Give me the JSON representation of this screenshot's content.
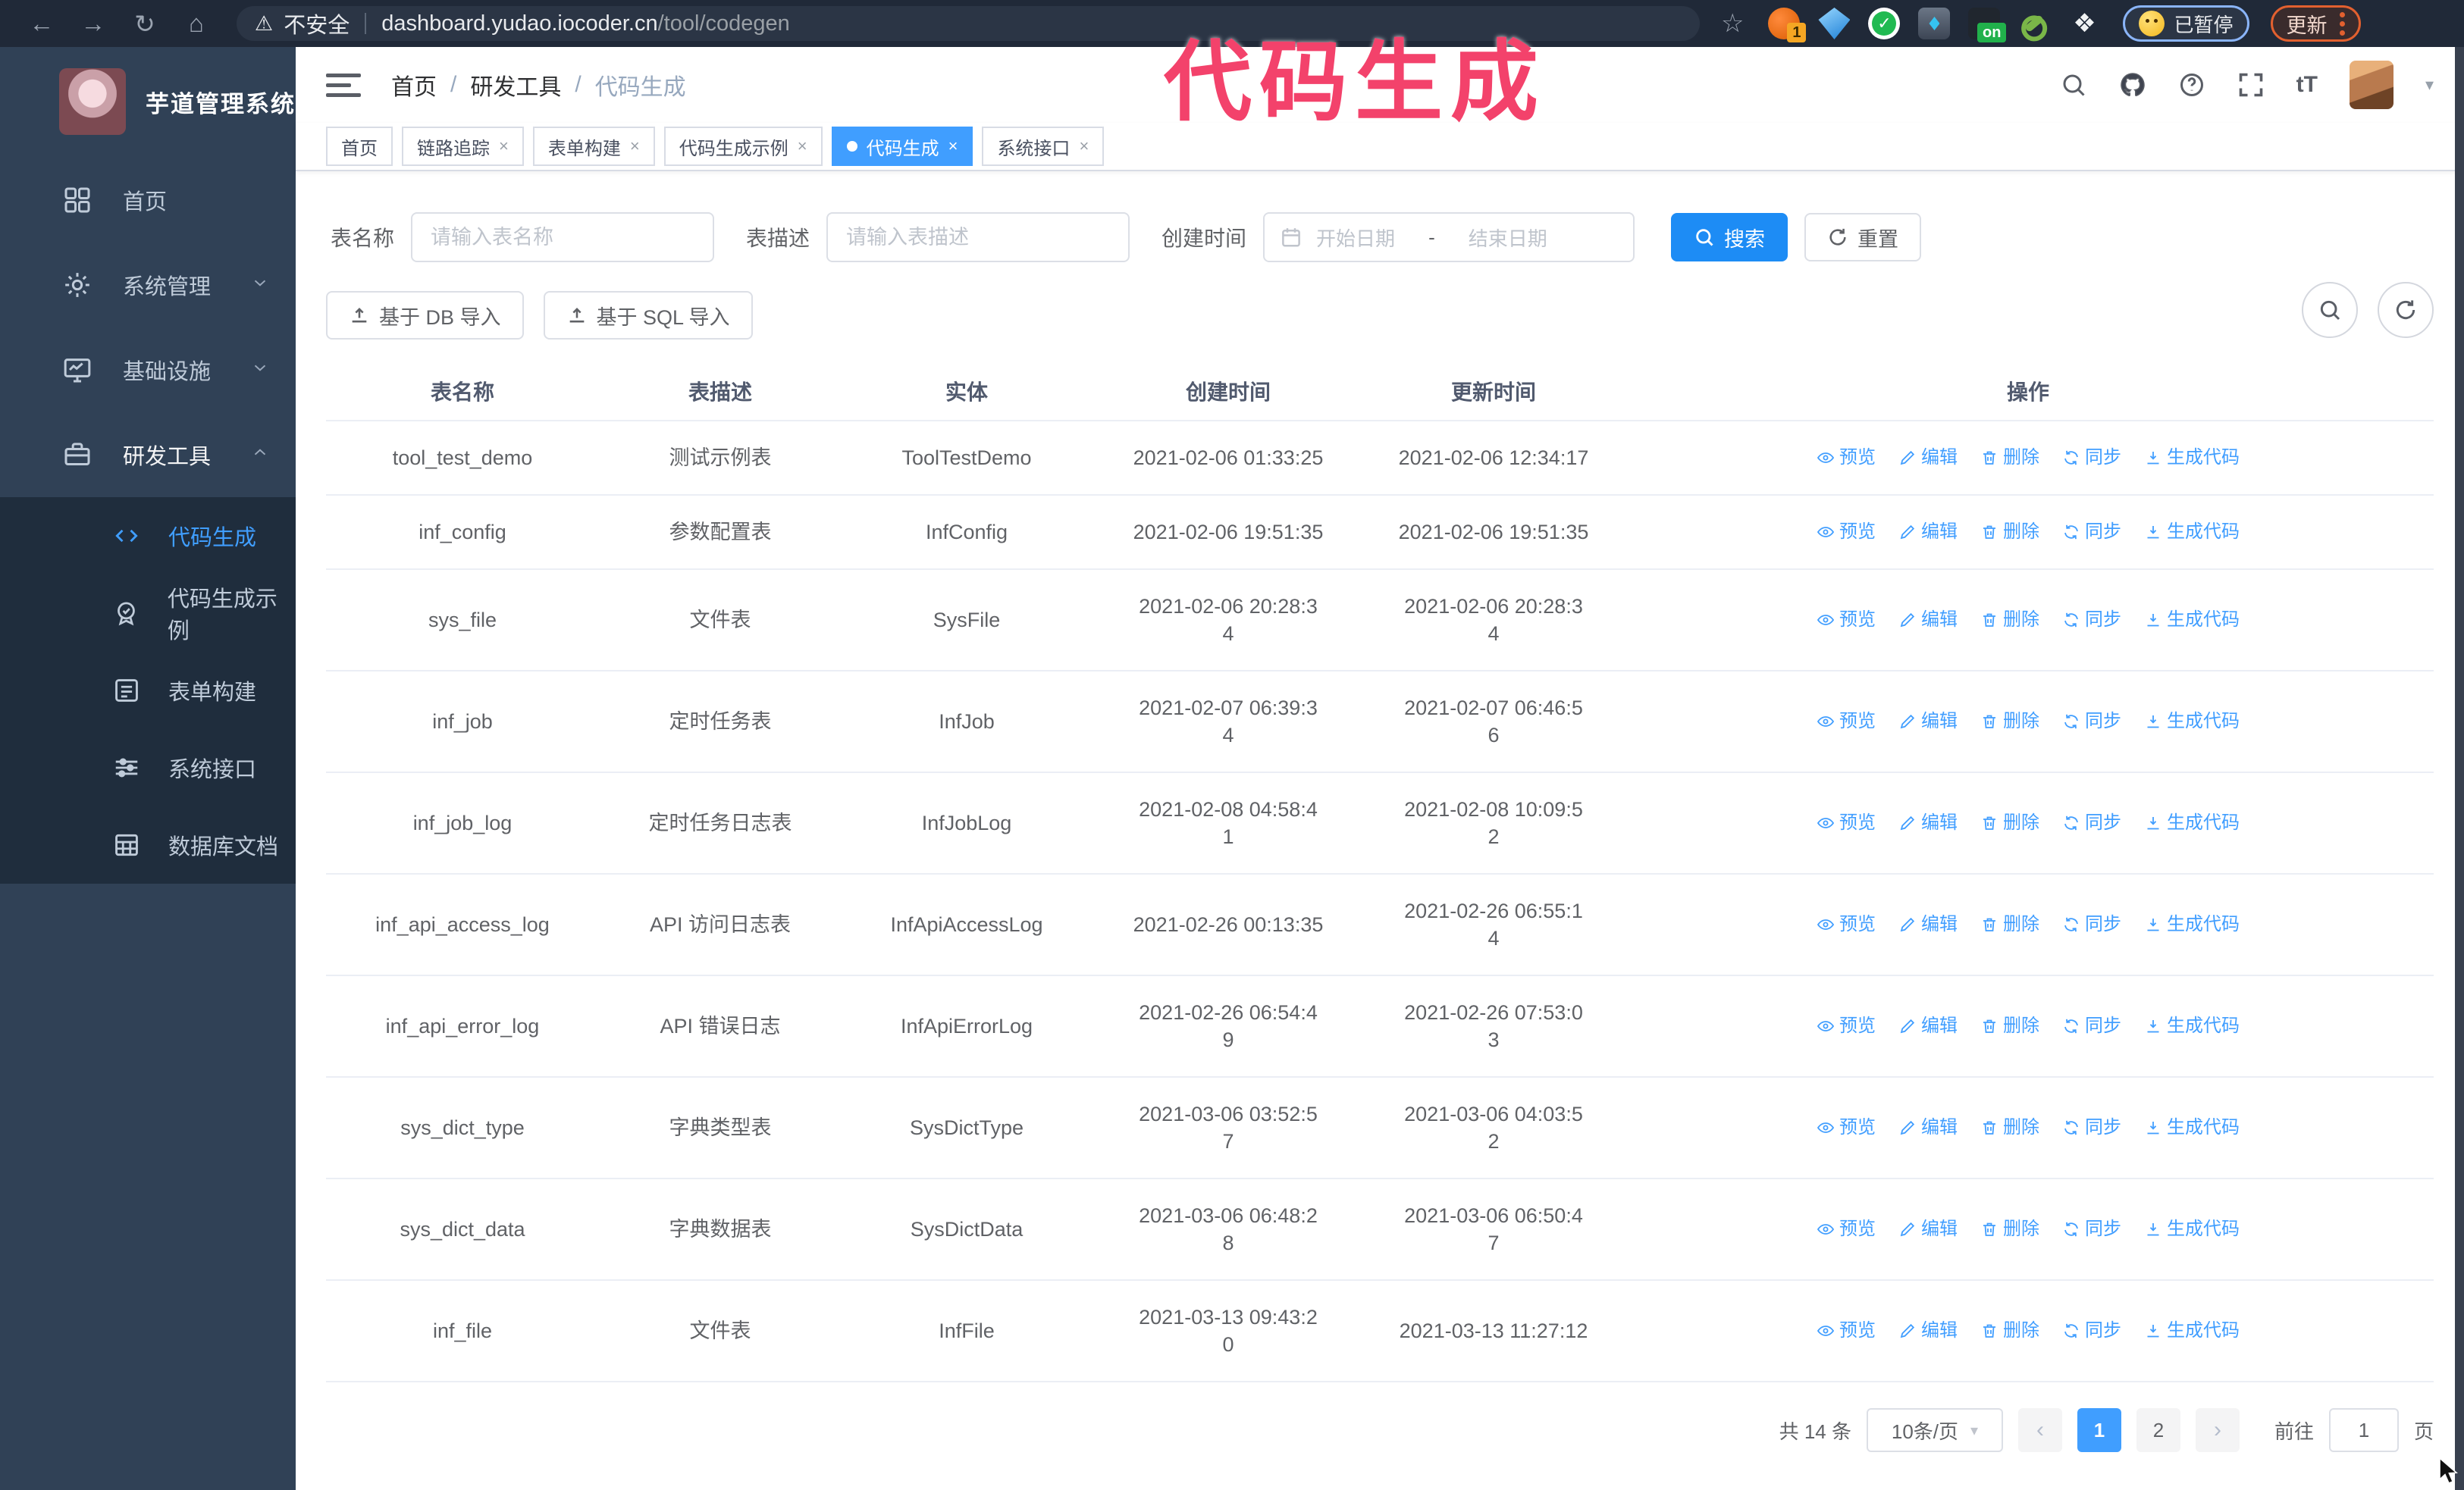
{
  "colors": {
    "primary": "#409eff",
    "search_button": "#1d8cf5",
    "sidebar_bg": "#304156",
    "submenu_bg": "#1f2d3d",
    "annotation_pink": "#f3426b",
    "tag_active": "#409eff"
  },
  "browser": {
    "security_label": "不安全",
    "url_host": "dashboard.yudao.iocoder.cn",
    "url_path": "/tool/codegen",
    "ext_badge": "1",
    "ext_on_badge": "on",
    "paused_label": "已暂停",
    "update_label": "更新"
  },
  "annotation": {
    "text": "代码生成"
  },
  "sidebar": {
    "title": "芋道管理系统",
    "items": [
      {
        "label": "首页",
        "icon": "dashboard-icon",
        "chevron": "",
        "open": false
      },
      {
        "label": "系统管理",
        "icon": "gear-icon",
        "chevron": "down",
        "open": false
      },
      {
        "label": "基础设施",
        "icon": "monitor-icon",
        "chevron": "down",
        "open": false
      },
      {
        "label": "研发工具",
        "icon": "toolbox-icon",
        "chevron": "up",
        "open": true
      }
    ],
    "submenu": [
      {
        "label": "代码生成",
        "icon": "code-icon",
        "active": true
      },
      {
        "label": "代码生成示例",
        "icon": "medal-icon",
        "active": false
      },
      {
        "label": "表单构建",
        "icon": "form-icon",
        "active": false
      },
      {
        "label": "系统接口",
        "icon": "sliders-icon",
        "active": false
      },
      {
        "label": "数据库文档",
        "icon": "db-doc-icon",
        "active": false
      }
    ]
  },
  "header": {
    "breadcrumb": [
      "首页",
      "研发工具",
      "代码生成"
    ]
  },
  "tabs": [
    {
      "label": "首页",
      "closable": false,
      "active": false
    },
    {
      "label": "链路追踪",
      "closable": true,
      "active": false
    },
    {
      "label": "表单构建",
      "closable": true,
      "active": false
    },
    {
      "label": "代码生成示例",
      "closable": true,
      "active": false
    },
    {
      "label": "代码生成",
      "closable": true,
      "active": true
    },
    {
      "label": "系统接口",
      "closable": true,
      "active": false
    }
  ],
  "filters": {
    "name_label": "表名称",
    "name_placeholder": "请输入表名称",
    "desc_label": "表描述",
    "desc_placeholder": "请输入表描述",
    "time_label": "创建时间",
    "start_placeholder": "开始日期",
    "range_separator": "-",
    "end_placeholder": "结束日期",
    "search_label": "搜索",
    "reset_label": "重置"
  },
  "toolbar": {
    "db_import": "基于 DB 导入",
    "sql_import": "基于 SQL 导入"
  },
  "table": {
    "columns": [
      "表名称",
      "表描述",
      "实体",
      "创建时间",
      "更新时间",
      "操作"
    ],
    "actions": [
      {
        "label": "预览",
        "icon": "eye-icon"
      },
      {
        "label": "编辑",
        "icon": "edit-icon"
      },
      {
        "label": "删除",
        "icon": "delete-icon"
      },
      {
        "label": "同步",
        "icon": "sync-icon"
      },
      {
        "label": "生成代码",
        "icon": "generate-code-icon"
      }
    ],
    "rows": [
      {
        "name": "tool_test_demo",
        "desc": "测试示例表",
        "entity": "ToolTestDemo",
        "created": "2021-02-06 01:33:25",
        "updated": "2021-02-06 12:34:17"
      },
      {
        "name": "inf_config",
        "desc": "参数配置表",
        "entity": "InfConfig",
        "created": "2021-02-06 19:51:35",
        "updated": "2021-02-06 19:51:35"
      },
      {
        "name": "sys_file",
        "desc": "文件表",
        "entity": "SysFile",
        "created": "2021-02-06 20:28:3\n4",
        "updated": "2021-02-06 20:28:3\n4"
      },
      {
        "name": "inf_job",
        "desc": "定时任务表",
        "entity": "InfJob",
        "created": "2021-02-07 06:39:3\n4",
        "updated": "2021-02-07 06:46:5\n6"
      },
      {
        "name": "inf_job_log",
        "desc": "定时任务日志表",
        "entity": "InfJobLog",
        "created": "2021-02-08 04:58:4\n1",
        "updated": "2021-02-08 10:09:5\n2"
      },
      {
        "name": "inf_api_access_log",
        "desc": "API 访问日志表",
        "entity": "InfApiAccessLog",
        "created": "2021-02-26 00:13:35",
        "updated": "2021-02-26 06:55:1\n4"
      },
      {
        "name": "inf_api_error_log",
        "desc": "API 错误日志",
        "entity": "InfApiErrorLog",
        "created": "2021-02-26 06:54:4\n9",
        "updated": "2021-02-26 07:53:0\n3"
      },
      {
        "name": "sys_dict_type",
        "desc": "字典类型表",
        "entity": "SysDictType",
        "created": "2021-03-06 03:52:5\n7",
        "updated": "2021-03-06 04:03:5\n2"
      },
      {
        "name": "sys_dict_data",
        "desc": "字典数据表",
        "entity": "SysDictData",
        "created": "2021-03-06 06:48:2\n8",
        "updated": "2021-03-06 06:50:4\n7"
      },
      {
        "name": "inf_file",
        "desc": "文件表",
        "entity": "InfFile",
        "created": "2021-03-13 09:43:2\n0",
        "updated": "2021-03-13 11:27:12"
      }
    ]
  },
  "pagination": {
    "total": "共 14 条",
    "page_size": "10条/页",
    "pages": [
      {
        "label": "1",
        "active": true
      },
      {
        "label": "2",
        "active": false
      }
    ],
    "goto_label": "前往",
    "goto_value": "1",
    "page_unit": "页"
  }
}
